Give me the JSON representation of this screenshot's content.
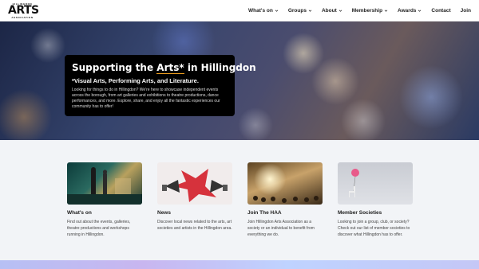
{
  "logo": {
    "top": "HILLINGDON",
    "big": "ARTS",
    "bottom": "ASSOCIATION"
  },
  "nav": [
    {
      "label": "What's on",
      "dropdown": true
    },
    {
      "label": "Groups",
      "dropdown": true
    },
    {
      "label": "About",
      "dropdown": true
    },
    {
      "label": "Membership",
      "dropdown": true
    },
    {
      "label": "Awards",
      "dropdown": true
    },
    {
      "label": "Contact",
      "dropdown": false
    },
    {
      "label": "Join",
      "dropdown": false
    }
  ],
  "hero": {
    "title_before": "Supporting the ",
    "title_accent": "Arts*",
    "title_after": " in Hillingdon",
    "subtitle": "*Visual Arts, Performing Arts, and Literature.",
    "description": "Looking for things to do in Hillingdon? We're here to showcase independent events across the borough, from art galleries and exhibitions to theatre productions, dance performances, and more. Explore, share, and enjoy all the fantastic experiences our community has to offer!"
  },
  "cards": [
    {
      "title": "What's on",
      "desc": "Find out about the events, galleries, theatre productions and workshops running in Hillingdon."
    },
    {
      "title": "News",
      "desc": "Discover local news related to the arts, art societies and artists in the Hillingdon area."
    },
    {
      "title": "Join The HAA",
      "desc": "Join Hillingdon Arts Association as a society or an individual to benefit from everything we do."
    },
    {
      "title": "Member Societies",
      "desc": "Looking to join a group, club, or society? Check out our list of member societies to discover what Hillingdon has to offer."
    }
  ],
  "colors": {
    "accent": "#f0a020",
    "hero_card_bg": "#000000",
    "page_bg": "#f2f4f7"
  }
}
